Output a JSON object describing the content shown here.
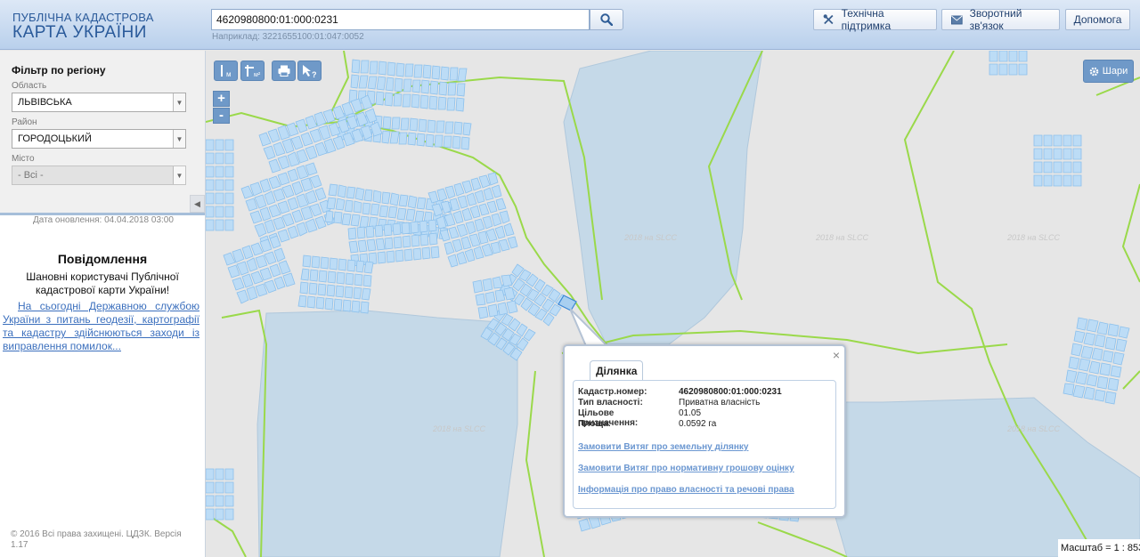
{
  "header": {
    "logo_line1": "ПУБЛІЧНА КАДАСТРОВА",
    "logo_line2": "КАРТА УКРАЇНИ",
    "search_value": "4620980800:01:000:0231",
    "search_hint": "Наприклад: 3221655100:01:047:0052",
    "support_label": "Технічна підтримка",
    "feedback_label": "Зворотний зв'язок",
    "help_label": "Допомога"
  },
  "sidebar": {
    "filter_title": "Фільтр по регіону",
    "oblast_label": "Область",
    "oblast_value": "ЛЬВІВСЬКА",
    "raion_label": "Район",
    "raion_value": "ГОРОДОЦЬКИЙ",
    "misto_label": "Місто",
    "misto_value": "- Всі -",
    "update_date": "Дата оновлення: 04.04.2018 03:00",
    "notice_title": "Повідомлення",
    "notice_text": "Шановні користувачі Публічної кадастрової карти України!",
    "notice_link": "На сьогодні Державною службою України з питань геодезії, картографії та кадастру здійснюються заходи із виправлення помилок...",
    "copyright": "© 2016 Всі права захищені. ЦДЗК. Версія 1.17"
  },
  "map": {
    "tool_meters": "м",
    "tool_area": "м²",
    "tool_query": "?",
    "zoom_in": "+",
    "zoom_out": "-",
    "layers_label": "Шари",
    "scale_label": "Масштаб = 1 : 8531",
    "watermark": "2018 на SLCC"
  },
  "popup": {
    "tab_label": "Ділянка",
    "close": "×",
    "fields": [
      {
        "key": "Кадастр.номер:",
        "value": "4620980800:01:000:0231",
        "bold": true
      },
      {
        "key": "Тип власності:",
        "value": "Приватна власність",
        "bold": false
      },
      {
        "key": "Цільове призначення:",
        "value": "01.05",
        "bold": false
      },
      {
        "key": "Площа:",
        "value": "0.0592 га",
        "bold": false
      }
    ],
    "links": [
      "Замовити Витяг про земельну ділянку",
      "Замовити Витяг про нормативну грошову оцінку",
      "Інформація про право власності та речові права"
    ]
  },
  "colors": {
    "parcel_fill": "#bcdcf6",
    "parcel_stroke": "#8cc0ec",
    "water": "#c5d9e8",
    "boundary": "#9ad94a",
    "accent": "#6f99c8"
  }
}
